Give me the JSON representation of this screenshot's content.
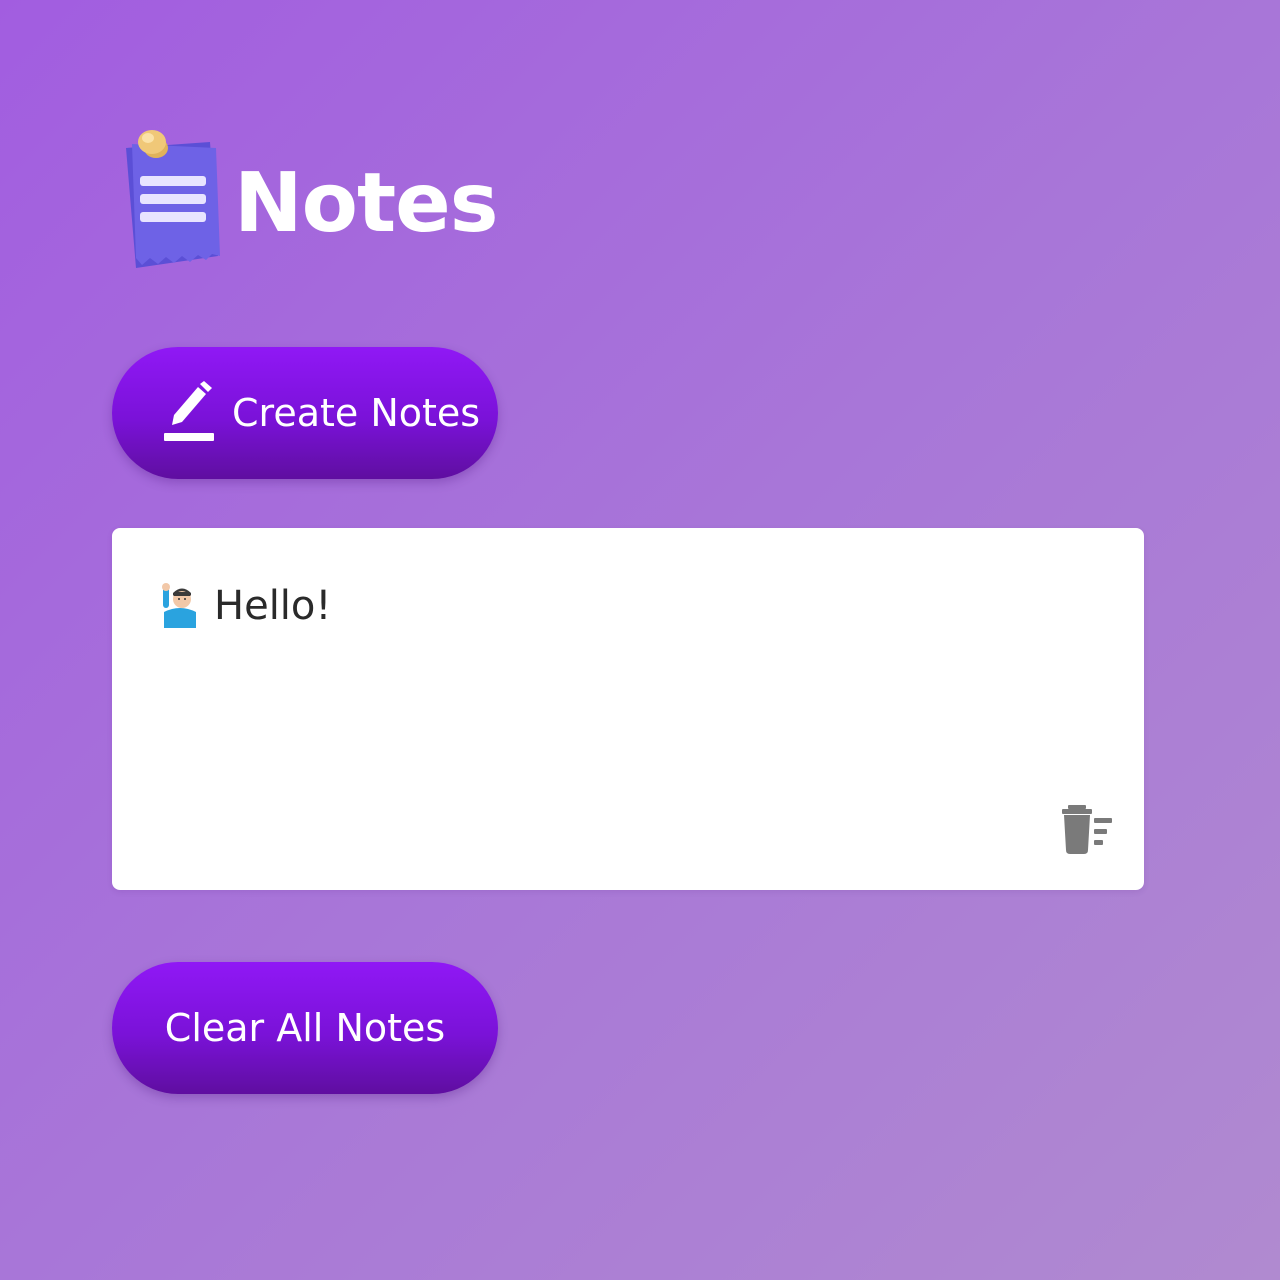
{
  "header": {
    "title": "Notes",
    "logo_icon": "notepad-icon"
  },
  "actions": {
    "create_label": "Create Notes",
    "create_icon": "pencil-icon",
    "clear_label": "Clear All Notes"
  },
  "notes": [
    {
      "emoji_icon": "person-raising-hand-icon",
      "text": "Hello!",
      "delete_icon": "trash-icon"
    }
  ],
  "colors": {
    "accent": "#8a16ea",
    "accent_dark": "#5f0ea0",
    "background": "#a86cd8",
    "card": "#ffffff"
  }
}
